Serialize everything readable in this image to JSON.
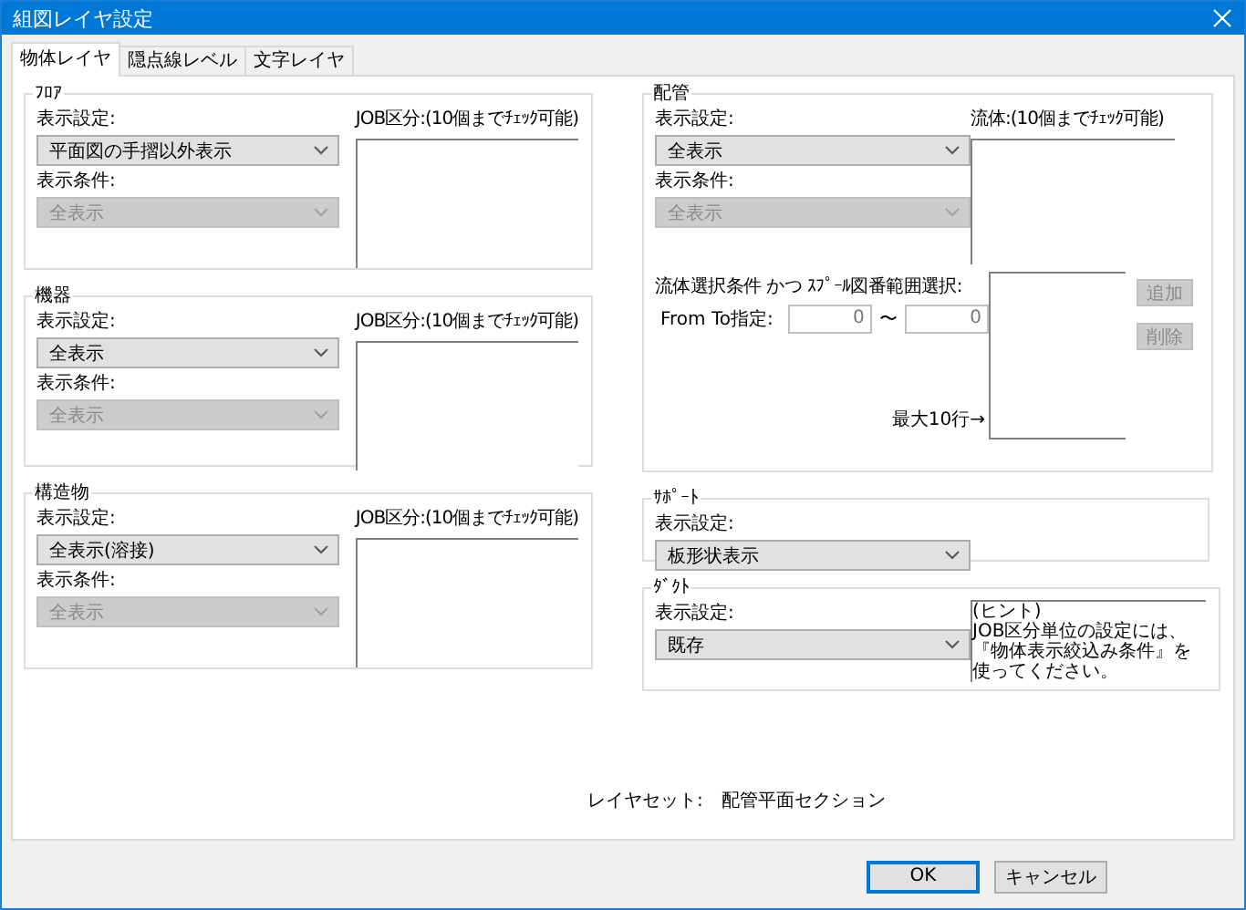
{
  "window": {
    "title": "組図レイヤ設定"
  },
  "tabs": [
    {
      "label": "物体レイヤ",
      "selected": true
    },
    {
      "label": "隠点線レベル",
      "selected": false
    },
    {
      "label": "文字レイヤ",
      "selected": false
    }
  ],
  "left_groups": [
    {
      "title": "ﾌﾛｱ",
      "settings": [
        {
          "label": "表示設定:",
          "value": "平面図の手摺以外表示",
          "disabled": false
        },
        {
          "label": "表示条件:",
          "value": "全表示",
          "disabled": true
        }
      ],
      "list_label": "JOB区分:(10個までﾁｪｯｸ可能)"
    },
    {
      "title": "機器",
      "settings": [
        {
          "label": "表示設定:",
          "value": "全表示",
          "disabled": false
        },
        {
          "label": "表示条件:",
          "value": "全表示",
          "disabled": true
        }
      ],
      "list_label": "JOB区分:(10個までﾁｪｯｸ可能)"
    },
    {
      "title": "構造物",
      "settings": [
        {
          "label": "表示設定:",
          "value": "全表示(溶接)",
          "disabled": false
        },
        {
          "label": "表示条件:",
          "value": "全表示",
          "disabled": true
        }
      ],
      "list_label": "JOB区分:(10個までﾁｪｯｸ可能)"
    }
  ],
  "piping": {
    "title": "配管",
    "settings": [
      {
        "label": "表示設定:",
        "value": "全表示",
        "disabled": false
      },
      {
        "label": "表示条件:",
        "value": "全表示",
        "disabled": true
      }
    ],
    "list_label": "流体:(10個までﾁｪｯｸ可能)",
    "range_label": "流体選択条件 かつ ｽﾌﾟｰﾙ図番範囲選択:",
    "from_to_label": "From To指定:",
    "from_value": "0",
    "separator": "〜",
    "to_value": "0",
    "max_label": "最大10行→",
    "buttons": [
      {
        "label": "追加",
        "disabled": true
      },
      {
        "label": "削除",
        "disabled": true
      }
    ]
  },
  "support": {
    "title": "ｻﾎﾟｰﾄ",
    "settings": [
      {
        "label": "表示設定:",
        "value": "板形状表示",
        "disabled": false
      }
    ]
  },
  "duct": {
    "title": "ﾀﾞｸﾄ",
    "settings": [
      {
        "label": "表示設定:",
        "value": "既存",
        "disabled": false
      }
    ],
    "hint_title": "(ヒント)",
    "hint": "JOB区分単位の設定には、『物体表示絞込み条件』を使ってください。"
  },
  "layer_set": {
    "label": "レイヤセット:",
    "value": "配管平面セクション"
  },
  "buttons": [
    {
      "label": "OK",
      "default": true
    },
    {
      "label": "キャンセル",
      "default": false
    }
  ]
}
